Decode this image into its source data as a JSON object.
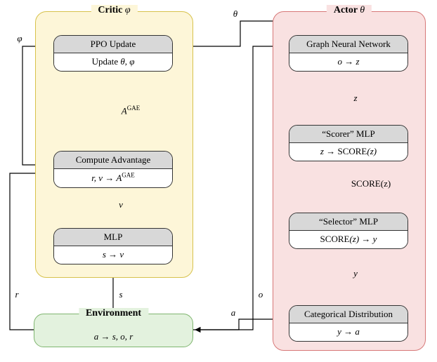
{
  "panels": {
    "critic": {
      "title_html": "Critic <span style=\"font-style:italic;font-weight:normal\">φ</span>"
    },
    "actor": {
      "title_html": "Actor <span style=\"font-style:italic;font-weight:normal\">θ</span>"
    },
    "env": {
      "title": "Environment",
      "body_html": "a → s, o, r"
    }
  },
  "critic_blocks": {
    "ppo": {
      "title": "PPO Update",
      "body_html": "<span class=\"rm\">Update</span> θ, φ"
    },
    "adv": {
      "title": "Compute Advantage",
      "body_html": "r, v → A<sup><span class=\"rm\">GAE</span></sup>"
    },
    "mlp": {
      "title": "MLP",
      "body_html": "s → v"
    }
  },
  "actor_blocks": {
    "gnn": {
      "title": "Graph Neural Network",
      "body_html": "o → z"
    },
    "scor": {
      "title_html": "&ldquo;Scorer&rdquo; MLP",
      "body_html": "z → <span class=\"rm\">SCORE</span>(z)"
    },
    "sel": {
      "title_html": "&ldquo;Selector&rdquo; MLP",
      "body_html": "<span class=\"rm\">SCORE</span>(z) → y"
    },
    "cat": {
      "title": "Categorical Distribution",
      "body_html": "y → a"
    }
  },
  "edges": {
    "phi": {
      "html": "φ"
    },
    "theta": {
      "html": "θ"
    },
    "Agae": {
      "html": "A<sup><span class=\"rm\">GAE</span></sup>"
    },
    "v": {
      "html": "v"
    },
    "s": {
      "html": "s"
    },
    "r": {
      "html": "r"
    },
    "o": {
      "html": "o"
    },
    "a": {
      "html": "a"
    },
    "z": {
      "html": "z"
    },
    "scorez": {
      "html": "<span class=\"rm\">SCORE</span>(z)"
    },
    "y": {
      "html": "y"
    }
  }
}
